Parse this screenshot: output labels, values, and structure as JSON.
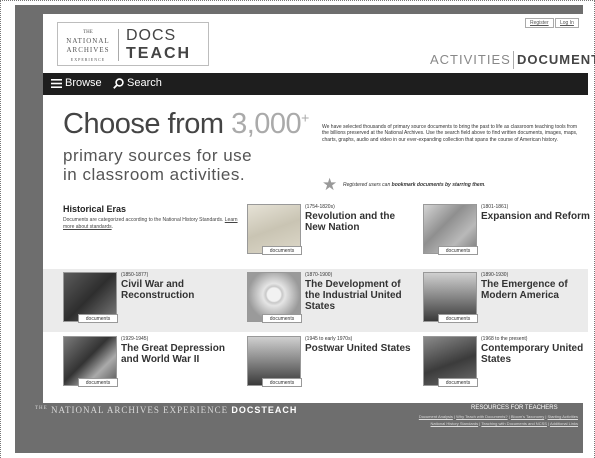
{
  "header": {
    "logo": {
      "the": "THE",
      "national": "NATIONAL",
      "archives": "ARCHIVES",
      "experience": "EXPERIENCE",
      "docs": "DOCS",
      "teach": "TEACH"
    },
    "register": "Register",
    "login": "Log In",
    "nav": {
      "activities": "ACTIVITIES",
      "documents": "DOCUMENTS"
    }
  },
  "toolbar": {
    "browse": "Browse",
    "search": "Search"
  },
  "hero": {
    "line1_prefix": "Choose from ",
    "number": "3,000",
    "plus": "+",
    "line2": "primary sources for use",
    "line3": "in classroom activities.",
    "description": "We have selected thousands of primary source documents to bring the past to life as classroom teaching tools from the billions preserved at the National Archives. Use the search field above to find written documents, images, maps, charts, graphs, audio and video in our ever-expanding collection that spans the course of American history.",
    "star_note_prefix": "Registered users can ",
    "star_note_bold": "bookmark documents by starring them",
    "star_note_suffix": "."
  },
  "eras_intro": {
    "title": "Historical Eras",
    "desc_prefix": "Documents are categorized according to the National History Standards. ",
    "desc_link": "Learn more about standards",
    "desc_suffix": "."
  },
  "eras": [
    {
      "date": "(1754-1820s)",
      "name": "Revolution and the New Nation",
      "tag": "documents"
    },
    {
      "date": "(1801-1861)",
      "name": "Expansion and Reform",
      "tag": "documents"
    },
    {
      "date": "(1850-1877)",
      "name": "Civil War and Reconstruction",
      "tag": "documents"
    },
    {
      "date": "(1870-1900)",
      "name": "The Development of the Industrial United States",
      "tag": "documents"
    },
    {
      "date": "(1890-1930)",
      "name": "The Emergence of Modern America",
      "tag": "documents"
    },
    {
      "date": "(1929-1945)",
      "name": "The Great Depression and World War II",
      "tag": "documents"
    },
    {
      "date": "(1945 to early 1970s)",
      "name": "Postwar United States",
      "tag": "documents"
    },
    {
      "date": "(1968 to the present)",
      "name": "Contemporary United States",
      "tag": "documents"
    }
  ],
  "footer": {
    "the": "THE",
    "brand": "NATIONAL ARCHIVES EXPERIENCE",
    "docs": "DOCSTEACH",
    "resources_title": "RESOURCES FOR TEACHERS",
    "links": [
      "Document Analysis",
      "Why Teach with Documents?",
      "Bloom's Taxonomy",
      "Starting Activities",
      "National History Standards",
      "Teaching with Documents and NCSS",
      "Additional Links"
    ]
  },
  "icons": {
    "browse": "menu-icon",
    "search": "search-icon",
    "star": "star-icon"
  }
}
